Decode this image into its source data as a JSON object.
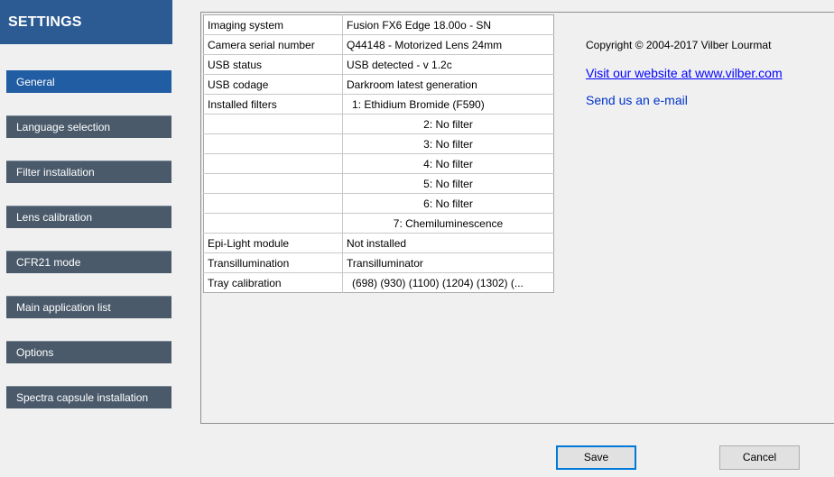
{
  "sidebar": {
    "title": "SETTINGS",
    "items": [
      {
        "label": "General",
        "active": true
      },
      {
        "label": "Language selection",
        "active": false
      },
      {
        "label": "Filter installation",
        "active": false
      },
      {
        "label": "Lens calibration",
        "active": false
      },
      {
        "label": "CFR21 mode",
        "active": false
      },
      {
        "label": "Main application list",
        "active": false
      },
      {
        "label": "Options",
        "active": false
      },
      {
        "label": "Spectra capsule installation",
        "active": false
      }
    ]
  },
  "info_table": {
    "rows": [
      {
        "label": "Imaging system",
        "value": "Fusion  FX6 Edge 18.00o - SN"
      },
      {
        "label": "Camera serial number",
        "value": "Q44148  - Motorized Lens 24mm"
      },
      {
        "label": "USB status",
        "value": "USB detected - v 1.2c"
      },
      {
        "label": "USB codage",
        "value": "Darkroom latest generation"
      },
      {
        "label": "Installed filters",
        "value": "1: Ethidium Bromide (F590)"
      },
      {
        "label": "",
        "value": "2: No filter"
      },
      {
        "label": "",
        "value": "3: No filter"
      },
      {
        "label": "",
        "value": "4: No filter"
      },
      {
        "label": "",
        "value": "5: No filter"
      },
      {
        "label": "",
        "value": "6: No filter"
      },
      {
        "label": "",
        "value": "7: Chemiluminescence"
      },
      {
        "label": "Epi-Light module",
        "value": "Not installed"
      },
      {
        "label": "Transillumination",
        "value": "Transilluminator"
      },
      {
        "label": "Tray calibration",
        "value": "(698) (930) (1100) (1204) (1302) (..."
      }
    ]
  },
  "about": {
    "copyright": "Copyright © 2004-2017 Vilber Lourmat",
    "website": "Visit our website at www.vilber.com",
    "email": "Send us an e-mail"
  },
  "buttons": {
    "save": "Save",
    "cancel": "Cancel"
  },
  "colors": {
    "header_bg": "#2c5b93",
    "active_item": "#205da3",
    "nav_item": "#4a5a6b",
    "link": "#0000ff"
  }
}
